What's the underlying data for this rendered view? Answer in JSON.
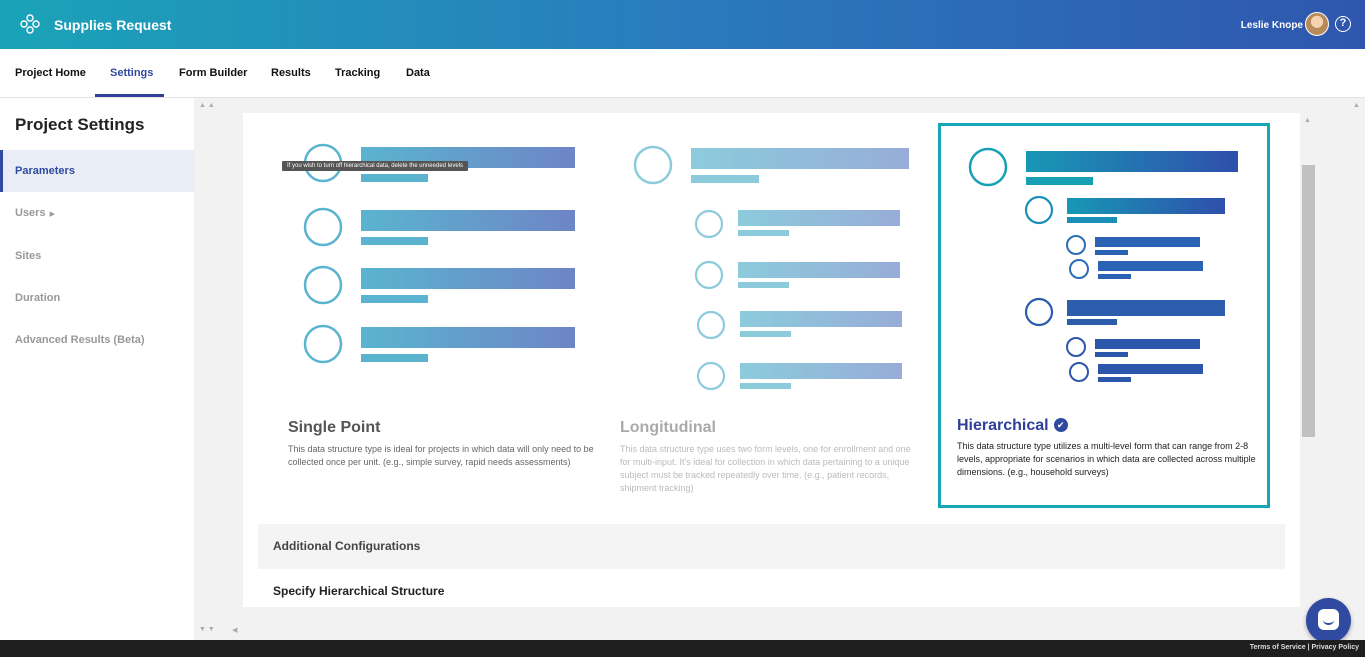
{
  "header": {
    "app_title": "Supplies Request",
    "user_name": "Leslie Knope",
    "help_label": "?"
  },
  "nav": {
    "tabs": [
      {
        "label": "Project Home"
      },
      {
        "label": "Settings",
        "active": true
      },
      {
        "label": "Form Builder"
      },
      {
        "label": "Results"
      },
      {
        "label": "Tracking"
      },
      {
        "label": "Data"
      }
    ]
  },
  "sidebar": {
    "heading": "Project Settings",
    "items": [
      {
        "label": "Parameters",
        "active": true
      },
      {
        "label": "Users",
        "has_submenu": true
      },
      {
        "label": "Sites"
      },
      {
        "label": "Duration"
      },
      {
        "label": "Advanced Results (Beta)"
      }
    ]
  },
  "tooltip": "If you wish to turn off hierarchical data, delete the unneeded levels",
  "structures": [
    {
      "title": "Single Point",
      "description": "This data structure type is ideal for projects in which data will only need to be collected once per unit. (e.g., simple survey, rapid needs assessments)",
      "state": "available"
    },
    {
      "title": "Longitudinal",
      "description": "This data structure type uses two form levels, one for enrollment and one for multi-input. It's ideal for collection in which data pertaining to a unique subject must be tracked repeatedly over time. (e.g., patient records, shipment tracking)",
      "state": "disabled"
    },
    {
      "title": "Hierarchical",
      "description": "This data structure type utilizes a multi-level form that can range from 2-8 levels, appropriate for scenarios in which data are collected across multiple dimensions. (e.g., household surveys)",
      "state": "selected",
      "check_icon": "✔"
    }
  ],
  "additional_configurations": "Additional Configurations",
  "specify_structure": "Specify Hierarchical Structure",
  "footer": {
    "terms": "Terms of Service",
    "privacy": "Privacy Policy"
  },
  "colors": {
    "accent": "#2f4aa0",
    "teal": "#17a5b8"
  }
}
